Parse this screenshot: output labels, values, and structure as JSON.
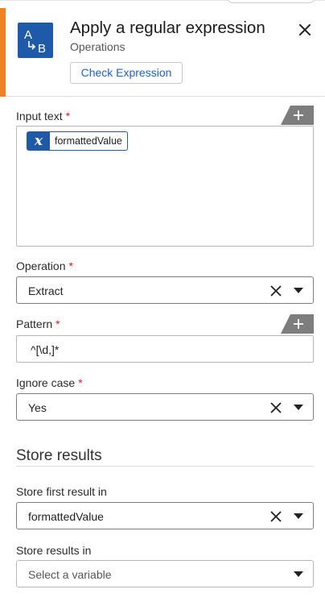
{
  "header": {
    "title": "Apply a regular expression",
    "subtitle": "Operations",
    "check_button": "Check Expression",
    "icon": "regex-replace-icon",
    "accent_color": "#f08224",
    "icon_color": "#1e5aa8"
  },
  "fields": {
    "input_text": {
      "label": "Input text",
      "required": "*",
      "token": {
        "icon": "variable-x-icon",
        "text": "formattedValue"
      }
    },
    "operation": {
      "label": "Operation",
      "required": "*",
      "value": "Extract"
    },
    "pattern": {
      "label": "Pattern",
      "required": "*",
      "value": "^[\\d,]*"
    },
    "ignore_case": {
      "label": "Ignore case",
      "required": "*",
      "value": "Yes"
    }
  },
  "store": {
    "section_title": "Store results",
    "first_result": {
      "label": "Store first result in",
      "value": "formattedValue"
    },
    "results": {
      "label": "Store results in",
      "placeholder": "Select a variable"
    }
  }
}
